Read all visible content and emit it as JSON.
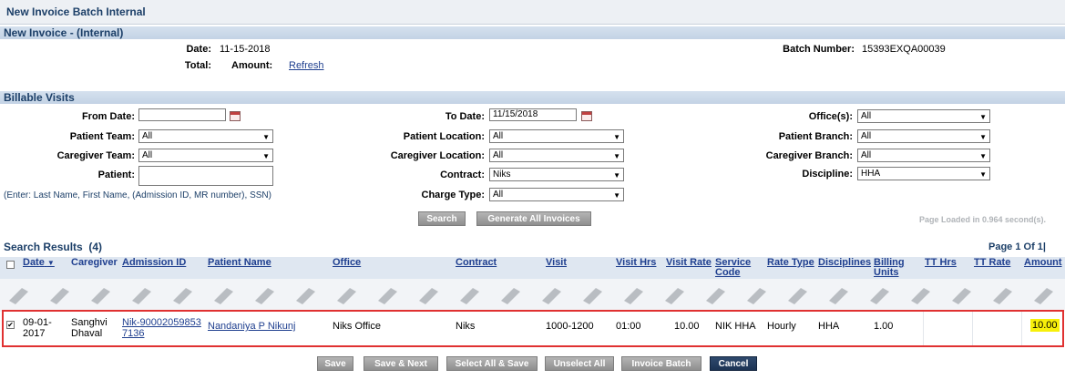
{
  "page": {
    "title": "New Invoice Batch Internal"
  },
  "invoice": {
    "section_title": "New Invoice - (Internal)",
    "date_label": "Date:",
    "date": "11-15-2018",
    "total_label": "Total:",
    "amount_label": "Amount:",
    "refresh": "Refresh",
    "batch_label": "Batch Number:",
    "batch_number": "15393EXQA00039"
  },
  "filters": {
    "section_title": "Billable Visits",
    "from_date_label": "From Date:",
    "from_date": "",
    "to_date_label": "To Date:",
    "to_date": "11/15/2018",
    "offices_label": "Office(s):",
    "offices": "All",
    "patient_team_label": "Patient Team:",
    "patient_team": "All",
    "patient_location_label": "Patient Location:",
    "patient_location": "All",
    "patient_branch_label": "Patient Branch:",
    "patient_branch": "All",
    "caregiver_team_label": "Caregiver Team:",
    "caregiver_team": "All",
    "caregiver_location_label": "Caregiver Location:",
    "caregiver_location": "All",
    "caregiver_branch_label": "Caregiver Branch:",
    "caregiver_branch": "All",
    "patient_label": "Patient:",
    "patient": "",
    "contract_label": "Contract:",
    "contract": "Niks",
    "discipline_label": "Discipline:",
    "discipline": "HHA",
    "charge_type_label": "Charge Type:",
    "charge_type": "All",
    "patient_hint": "(Enter: Last Name, First Name, (Admission ID, MR number), SSN)",
    "search_button": "Search",
    "generate_button": "Generate All Invoices",
    "page_loaded": "Page Loaded in 0.964 second(s)."
  },
  "results": {
    "title": "Search Results  (4)",
    "pager": "Page 1 Of 1|",
    "columns": {
      "date": "Date",
      "caregiver": "Caregiver",
      "admission_id": "Admission ID",
      "patient_name": "Patient Name",
      "office": "Office",
      "contract": "Contract",
      "visit": "Visit",
      "visit_hrs": "Visit Hrs",
      "visit_rate": "Visit Rate",
      "service_code": "Service Code",
      "rate_type": "Rate Type",
      "disciplines": "Disciplines",
      "billing_units": "Billing Units",
      "tt_hrs": "TT Hrs",
      "tt_rate": "TT Rate",
      "amount": "Amount"
    },
    "row": {
      "date": "09-01-2017",
      "caregiver": "Sanghvi Dhaval",
      "admission_id": "Nik-900020598537136",
      "patient_name": "Nandaniya P Nikunj",
      "office": "Niks Office",
      "contract": "Niks",
      "visit": "1000-1200",
      "visit_hrs": "01:00",
      "visit_rate": "10.00",
      "service_code": "NIK HHA",
      "rate_type": "Hourly",
      "disciplines": "HHA",
      "billing_units": "1.00",
      "tt_hrs": "",
      "tt_rate": "",
      "amount": "10.00"
    }
  },
  "actions": {
    "save": "Save",
    "save_next": "Save & Next",
    "select_all_save": "Select All & Save",
    "unselect_all": "Unselect All",
    "invoice_batch": "Invoice Batch",
    "cancel": "Cancel"
  },
  "colors": {
    "accent": "#1c3f68",
    "link": "#1f3f8f",
    "highlight": "#f7f00a",
    "selection_border": "#e03131"
  }
}
